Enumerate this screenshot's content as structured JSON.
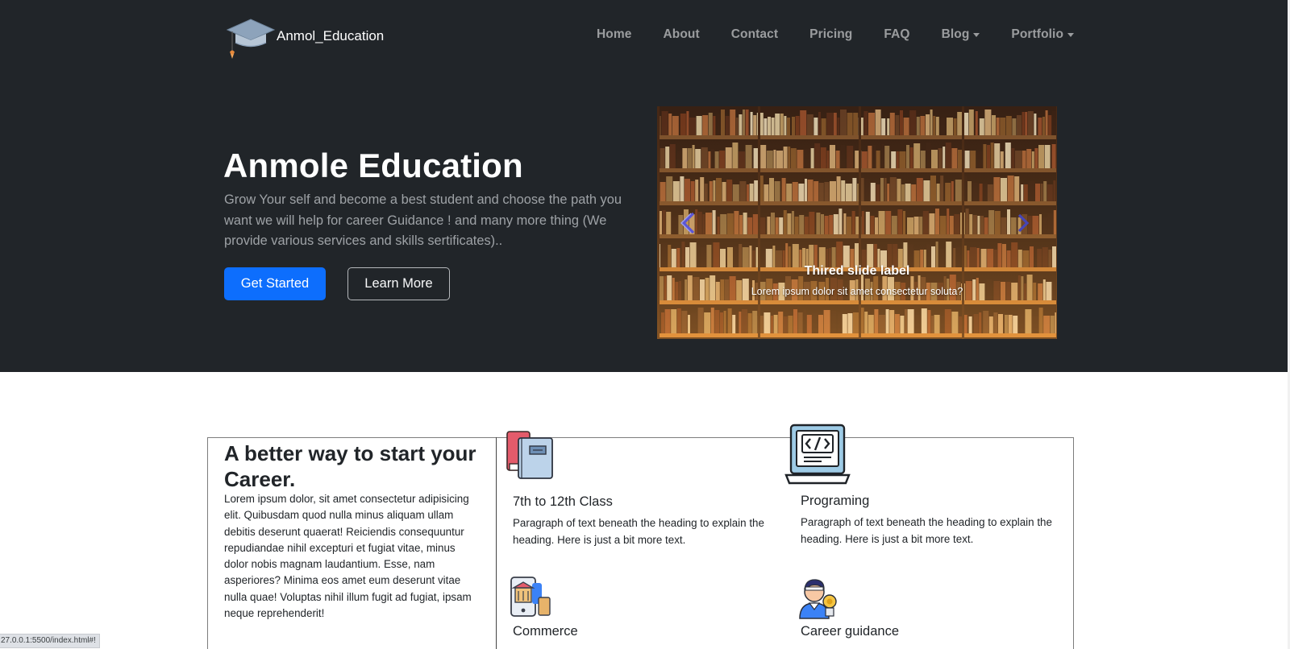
{
  "brand": {
    "name": "Anmol_Education",
    "logo_icon": "graduation-cap-icon"
  },
  "nav": {
    "items": [
      {
        "label": "Home",
        "dropdown": false
      },
      {
        "label": "About",
        "dropdown": false
      },
      {
        "label": "Contact",
        "dropdown": false
      },
      {
        "label": "Pricing",
        "dropdown": false
      },
      {
        "label": "FAQ",
        "dropdown": false
      },
      {
        "label": "Blog",
        "dropdown": true
      },
      {
        "label": "Portfolio",
        "dropdown": true
      }
    ]
  },
  "hero": {
    "title": "Anmole Education",
    "text": "Grow Your self and become a best student and choose the path you want we will help for career Guidance ! and many more thing (We provide various services and skills sertificates)..",
    "primary_button": "Get Started",
    "secondary_button": "Learn More"
  },
  "carousel": {
    "caption_title": "Thired slide label",
    "caption_text": "Lorem ipsum dolor sit amet consectetur soluta?",
    "prev_icon": "chevron-left-icon",
    "next_icon": "chevron-right-icon"
  },
  "features": {
    "heading": "A better way to start your Career.",
    "text": "Lorem ipsum dolor, sit amet consectetur adipisicing elit. Quibusdam quod nulla minus aliquam ullam debitis deserunt quaerat! Reiciendis consequuntur repudiandae nihil excepturi et fugiat vitae, minus dolor nobis magnam laudantium. Esse, nam asperiores? Minima eos amet eum deserunt vitae nulla quae! Voluptas nihil illum fugit ad fugiat, ipsam neque reprehenderit!",
    "items": [
      {
        "title": "7th to 12th Class",
        "text": "Paragraph of text beneath the heading to explain the heading. Here is just a bit more text.",
        "icon": "books-icon"
      },
      {
        "title": "Programing",
        "text": "Paragraph of text beneath the heading to explain the heading. Here is just a bit more text.",
        "icon": "laptop-code-icon"
      },
      {
        "title": "Commerce",
        "text": "",
        "icon": "mobile-shop-icon"
      },
      {
        "title": "Career guidance",
        "text": "",
        "icon": "graduate-trophy-icon"
      }
    ]
  },
  "status_bar": {
    "url": "27.0.0.1:5500/index.html#!"
  }
}
